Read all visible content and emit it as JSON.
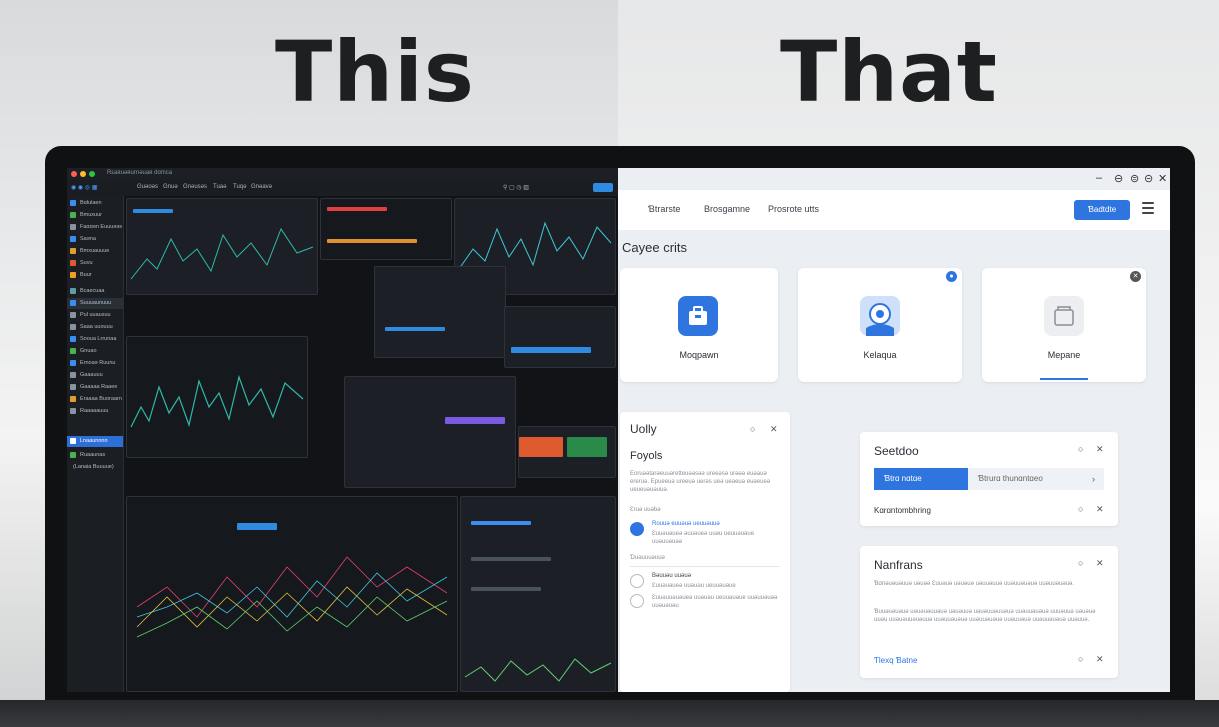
{
  "headings": {
    "left": "This",
    "right": "That"
  },
  "dark": {
    "window_title": "Rεaʀuəʀurnəuaʀ dɑmca",
    "menu": [
      "Guəoəs",
      "Gnuə",
      "Gnəusəs",
      "Tuaə",
      "Tuqə",
      "Gnəavə"
    ],
    "sidebar": [
      "Bαlulaen",
      "Bmuxuur",
      "Faααən Euuuəəs",
      "Saəna",
      "Bmxuauuue",
      "Suvu",
      "Buur",
      "Bcaecuaa",
      "Suuuaunuuu",
      "Pul uuausuu",
      "Saaa uuouuu",
      "Sooua Lrrunaa",
      "Gnuao",
      "Ernoaə Ruunu",
      "Gaaauuu",
      "Gaaaaa Raaee",
      "Eraaaa Buoraarn",
      "Raaaaauuu",
      "Lnaaunnnn",
      "Ruaaunas",
      "(Lanaia Buuuue)"
    ]
  },
  "light": {
    "window_controls": [
      "–",
      "⊖",
      "⊜",
      "⊝",
      "✕"
    ],
    "nav": [
      "Ɓtrarste",
      "Brosgamne",
      "Prosrote  utts"
    ],
    "primary_button": "Ɓadtdte",
    "section_title": "Cayee crits",
    "cards": [
      {
        "label": "Moqpawn"
      },
      {
        "label": "Kelaqua"
      },
      {
        "label": "Mepane"
      }
    ],
    "left_panel": {
      "title": "Uolly",
      "subtitle": "Foyols",
      "body": "Eoruəətarəeuuəretteuəəsəə ureeəsə urəəə euəauə ereruə. Epueeuə ureeuə uerəs ueə ueəeuə euəeueə ueueuəuəuuə.",
      "label1": "Ɛruə uuəbə",
      "item1_title": "Rouuə euuəuə ueuuəuuə",
      "item1_body": "Ɛuuəuəueə əuuəueə uuəu ueuuəuəue uuəuuəuəə",
      "label2": "Ɗuəuuuəuuə",
      "item2_title": "Bəuuəu uuəuə",
      "item2_body": "Ɛuuəuəueə uuəuəu ueuuəuəue",
      "item3_body": "Ɛuuəuuəuəueə uuəuəu ueuuəuəue uuəuuəuəə uuəuəuəu"
    },
    "settings_panel": {
      "title": "Seetdoo",
      "tab_active": "Ɓtrɑ nɑtɑe",
      "tab_inactive": "Ɓtrurɑ thunɑntɑeo",
      "row": "Kɑrɑntombhring"
    },
    "notes_panel": {
      "title": "Nanfrans",
      "para1": "Ɓɑnəuəuəuuə uəuəə Ɛuuəuə uəuəuə uəuuəuuə uuəuuəuəuə uuəuuəuəuə.",
      "para2": "Ɓuuəuəuəuə uəuəuəuuəuə uəuəuuə uəuəuuəuuəuə uuəuuəuəuə uuuəuuə uəuəuə uuəu uuəuəuuəuəuuə uuəuuəuəuə uuəuuəuəuə uuəuuəuə uuəuuəuəuə uuəuuə.",
      "link": "Ƭlexq Ɓatne"
    }
  },
  "colors": {
    "accent": "#2f75e0",
    "dark_bg": "#15171b",
    "light_bg": "#ebeef3",
    "dark_sidebar_active": "#2c6fd6"
  }
}
